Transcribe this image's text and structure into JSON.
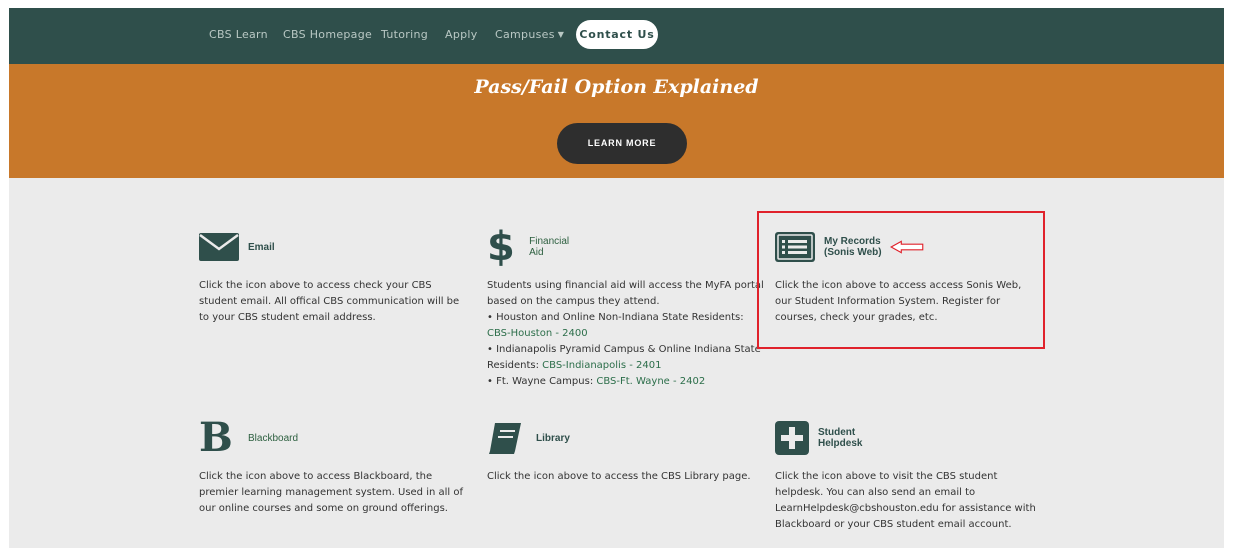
{
  "nav": {
    "links": [
      "CBS Learn",
      "CBS Homepage",
      "Tutoring",
      "Apply",
      "Campuses"
    ],
    "contact_label": "Contact Us"
  },
  "hero": {
    "title": "Pass/Fail Option Explained",
    "button_label": "LEARN MORE"
  },
  "cards": {
    "email": {
      "title": "Email",
      "text": "Click the icon above to access check your CBS student email. All offical CBS communication will be to your CBS student email address."
    },
    "financial_aid": {
      "title": "Financial Aid",
      "intro": "Students using financial aid will access the MyFA portal based on the campus they attend.",
      "item1": "• Houston and Online Non-Indiana State Residents:",
      "link1": "CBS-Houston - 2400",
      "item2": "• Indianapolis Pyramid Campus & Online Indiana State Residents:",
      "link2": "CBS-Indianapolis - 2401",
      "item3": "• Ft. Wayne Campus:",
      "link3": "CBS-Ft. Wayne - 2402"
    },
    "records": {
      "title": "My Records (Sonis Web)",
      "text": "Click the icon above to access access Sonis Web, our Student Information System. Register for courses, check your grades, etc."
    },
    "blackboard": {
      "title": "Blackboard",
      "icon_letter": "B",
      "text": "Click the icon above to access Blackboard, the premier learning management system. Used in all of our online courses and some on ground offerings."
    },
    "library": {
      "title": "Library",
      "text": "Click the icon above to access the CBS Library page."
    },
    "helpdesk": {
      "title": "Student Helpdesk",
      "text": "Click the icon above to visit the CBS student helpdesk. You can also send an email to LearnHelpdesk@cbshouston.edu for assistance with Blackboard or your CBS student email account."
    }
  },
  "colors": {
    "nav_bg": "#2f4f4b",
    "hero_bg": "#c8782a",
    "content_bg": "#ebebeb",
    "accent_green": "#2c6e4a",
    "annotation_red": "#e0222b"
  },
  "icons": [
    "envelope-icon",
    "dollar-icon",
    "list-icon",
    "blackboard-b-icon",
    "book-icon",
    "plus-square-icon",
    "red-arrow-icon"
  ]
}
